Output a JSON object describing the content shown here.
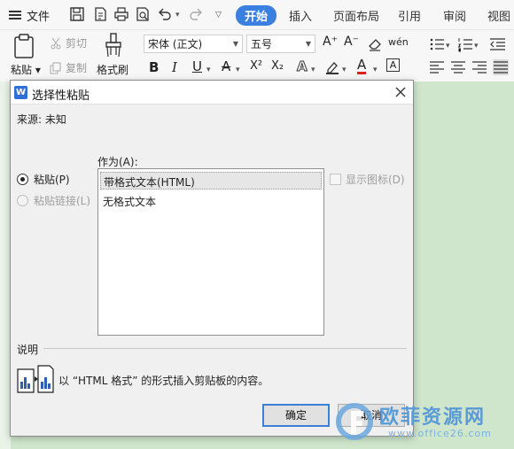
{
  "toolbar": {
    "file_label": "文件",
    "tabs": [
      {
        "label": "开始",
        "active": true
      },
      {
        "label": "插入"
      },
      {
        "label": "页面布局"
      },
      {
        "label": "引用"
      },
      {
        "label": "审阅"
      },
      {
        "label": "视图"
      }
    ]
  },
  "ribbon": {
    "paste_label": "粘贴",
    "cut_label": "剪切",
    "copy_label": "复制",
    "format_painter_label": "格式刷",
    "font_name": "宋体 (正文)",
    "font_size": "五号",
    "bold_glyph": "B",
    "italic_glyph": "I",
    "underline_glyph": "U",
    "strike_glyph": "A",
    "superscript_glyph": "X²",
    "subscript_glyph": "X₂",
    "effect_glyph": "A",
    "font_color_glyph": "A",
    "grow_font_glyph": "A⁺",
    "shrink_font_glyph": "A⁻",
    "pinyin_glyph": "wén"
  },
  "dialog": {
    "title": "选择性粘贴",
    "source": "来源: 未知",
    "as_label": "作为(A):",
    "options": [
      {
        "label": "粘贴(P)",
        "checked": true,
        "disabled": false
      },
      {
        "label": "粘贴链接(L)",
        "checked": false,
        "disabled": true
      }
    ],
    "formats": [
      {
        "label": "带格式文本(HTML)",
        "selected": true
      },
      {
        "label": "无格式文本",
        "selected": false
      }
    ],
    "show_as_icon_label": "显示图标(D)",
    "description_label": "说明",
    "description_text": "以 “HTML 格式” 的形式插入剪贴板的内容。",
    "ok_label": "确定",
    "cancel_label": "取消"
  },
  "watermark": {
    "name": "欧菲资源网",
    "url": "www.office26.com"
  },
  "colors": {
    "accent": "#3b7fe0",
    "document_bg": "#cfe6cc",
    "dialog_bg": "#f0f0f0"
  }
}
